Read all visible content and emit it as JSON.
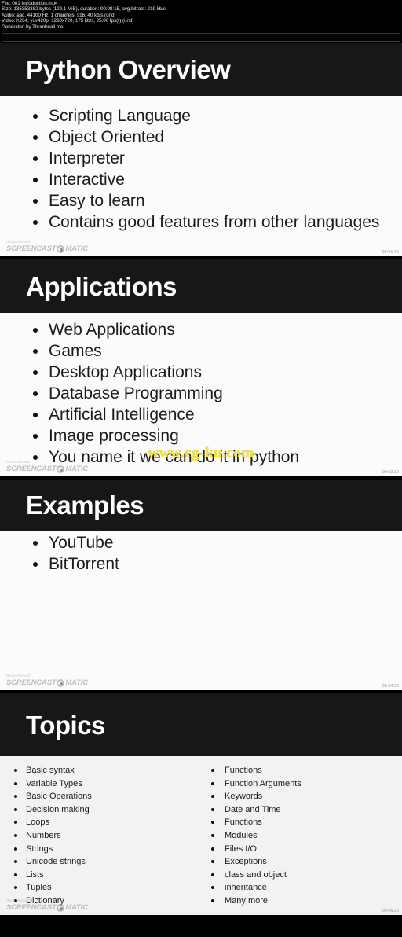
{
  "meta": {
    "lines": [
      "File: 001 Introduction.mp4",
      "Size: 135353382 bytes (129.1 MiB), duration: 00:08:15, avg.bitrate: 219 kb/s",
      "Audio: aac, 44100 Hz, 1 channels, s16, 40 kb/s (und)",
      "Video: h264, yuv420p, 1280x720, 175 kb/s, 25.00 fps(r) (und)",
      "Generated by Thumbnail me"
    ]
  },
  "watermark": {
    "recorded_with": "Recorded with",
    "logo_left": "SCREENCAST",
    "logo_right": "MATIC",
    "site": "www.cg-ku.com"
  },
  "frames": [
    {
      "title": "Python Overview",
      "timestamp": "00:01:40",
      "bullets": [
        "Scripting Language",
        "Object Oriented",
        "Interpreter",
        "Interactive",
        "Easy to learn",
        "Contains good features from other languages"
      ]
    },
    {
      "title": "Applications",
      "timestamp": "00:03:10",
      "bullets": [
        "Web Applications",
        "Games",
        "Desktop Applications",
        "Database Programming",
        "Artificial Intelligence",
        "Image processing",
        "You name it we can do it in python"
      ]
    },
    {
      "title": "Examples",
      "timestamp": "00:04:50",
      "bullets": [
        "YouTube",
        "BitTorrent"
      ]
    },
    {
      "title": "Topics",
      "timestamp": "00:06:20",
      "columns": {
        "left": [
          "Basic syntax",
          "Variable Types",
          "Basic Operations",
          "Decision making",
          "Loops",
          "Numbers",
          "Strings",
          "Unicode strings",
          "Lists",
          "Tuples",
          "Dictionary"
        ],
        "right": [
          "Functions",
          "Function Arguments",
          "Keywords",
          "Date and Time",
          "Functions",
          "Modules",
          "Files I/O",
          "Exceptions",
          "class and object",
          "inheritance",
          "Many more"
        ]
      }
    }
  ]
}
